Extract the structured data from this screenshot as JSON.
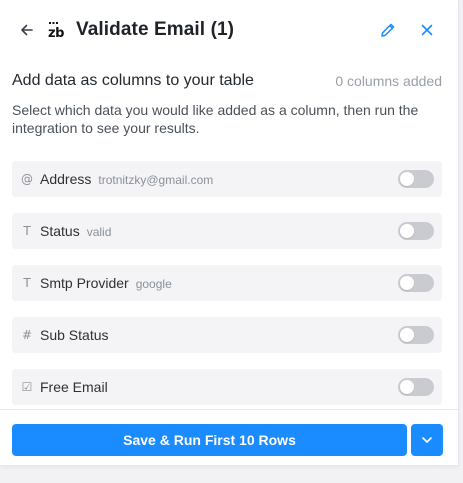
{
  "header": {
    "title": "Validate Email (1)",
    "logo_text": "zb"
  },
  "section": {
    "title": "Add data as columns to your table",
    "columns_count": "0 columns added",
    "description": "Select which data you would like added as a column, then run the integration to see your results."
  },
  "rows": [
    {
      "icon": "at-icon",
      "icon_glyph": "@",
      "label": "Address",
      "sample": "trotnitzky@gmail.com",
      "enabled": false
    },
    {
      "icon": "text-icon",
      "icon_glyph": "T",
      "label": "Status",
      "sample": "valid",
      "enabled": false
    },
    {
      "icon": "text-icon",
      "icon_glyph": "T",
      "label": "Smtp Provider",
      "sample": "google",
      "enabled": false
    },
    {
      "icon": "hash-icon",
      "icon_glyph": "#",
      "label": "Sub Status",
      "sample": "",
      "enabled": false
    },
    {
      "icon": "checkbox-icon",
      "icon_glyph": "☑",
      "label": "Free Email",
      "sample": "",
      "enabled": false
    }
  ],
  "footer": {
    "primary_label": "Save & Run First 10 Rows"
  },
  "colors": {
    "accent": "#1a8cff",
    "toggle_off": "#c9cbd0",
    "row_bg": "#f4f4f6"
  }
}
